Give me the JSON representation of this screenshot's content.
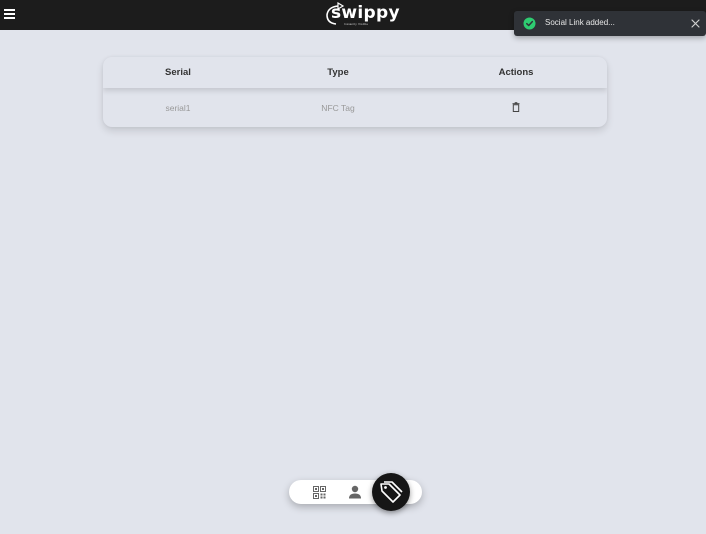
{
  "header": {
    "menu_icon": "hamburger-menu-icon",
    "logo_text": "swippy",
    "logo_subtext": "Instantly Visible"
  },
  "toast": {
    "message": "Social Link added...",
    "status_color": "#2ecc71",
    "icon": "check-circle-icon",
    "close_icon": "close-icon"
  },
  "table": {
    "columns": [
      "Serial",
      "Type",
      "Actions"
    ],
    "rows": [
      {
        "serial": "serial1",
        "type": "NFC Tag",
        "action_icon": "trash-icon"
      }
    ]
  },
  "bottom_nav": {
    "items": [
      {
        "icon": "qr-code-icon",
        "active": false
      },
      {
        "icon": "user-icon",
        "active": false
      },
      {
        "icon": "tag-icon",
        "active": true
      }
    ]
  },
  "colors": {
    "background": "#e1e4ec",
    "topbar": "#1c1c1c",
    "toast_bg": "#2f3237",
    "active_nav": "#161616"
  }
}
